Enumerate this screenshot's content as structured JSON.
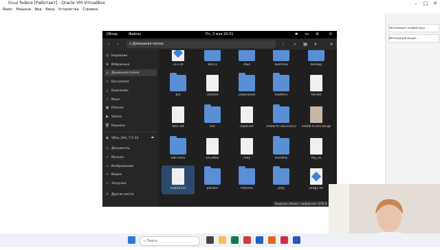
{
  "window": {
    "title": "linux fedora  [Работает] - Oracle VM VirtualBox"
  },
  "menu": [
    "Файл",
    "Машина",
    "Вид",
    "Ввод",
    "Устройства",
    "Справка"
  ],
  "topbar": {
    "overview": "Обзор",
    "app": "Файлы",
    "clock": "Пт, 3 мая  20:51",
    "lang": "ru"
  },
  "header": {
    "path": "Домашняя папка"
  },
  "sidebar": {
    "items": [
      {
        "label": "Недавние",
        "icon": "clock-icon"
      },
      {
        "label": "Избранные",
        "icon": "star-icon"
      },
      {
        "label": "Домашняя папка",
        "icon": "home-icon",
        "selected": true
      },
      {
        "label": "Documents",
        "icon": "folder-icon"
      },
      {
        "label": "Downloads",
        "icon": "download-icon"
      },
      {
        "label": "Music",
        "icon": "music-icon"
      },
      {
        "label": "Pictures",
        "icon": "image-icon"
      },
      {
        "label": "Videos",
        "icon": "video-icon"
      },
      {
        "label": "Корзина",
        "icon": "trash-icon"
      }
    ],
    "device": "VBox_GAs_7.0.14",
    "bookmarks": [
      {
        "label": "Документы",
        "icon": "folder-icon"
      },
      {
        "label": "Музыка",
        "icon": "folder-icon"
      },
      {
        "label": "Изображения",
        "icon": "folder-icon"
      },
      {
        "label": "Видео",
        "icon": "folder-icon"
      },
      {
        "label": "Загрузки",
        "icon": "folder-icon"
      }
    ],
    "other": "Другие места"
  },
  "files": [
    {
      "name": "111.sh",
      "kind": "script"
    },
    {
      "name": "abc11",
      "kind": "folder"
    },
    {
      "name": "ASD",
      "kind": "folder"
    },
    {
      "name": "australia",
      "kind": "folder"
    },
    {
      "name": "backup",
      "kind": "folder"
    },
    {
      "name": "bin",
      "kind": "folder"
    },
    {
      "name": "conf.txt",
      "kind": "doc"
    },
    {
      "name": "Downloads",
      "kind": "folder"
    },
    {
      "name": "feathers",
      "kind": "folder"
    },
    {
      "name": "file.txt",
      "kind": "doc"
    },
    {
      "name": "file1.txt",
      "kind": "doc"
    },
    {
      "name": "fun",
      "kind": "folder"
    },
    {
      "name": "input.txt",
      "kind": "doc"
    },
    {
      "name": "install-fc-20231012",
      "kind": "folder"
    },
    {
      "name": "install-tl-unx.tar.gz",
      "kind": "archive"
    },
    {
      "name": "lab-sssss",
      "kind": "folder"
    },
    {
      "name": "LICENSE",
      "kind": "doc"
    },
    {
      "name": "may",
      "kind": "doc"
    },
    {
      "name": "monthly",
      "kind": "folder"
    },
    {
      "name": "my_os",
      "kind": "doc"
    },
    {
      "name": "output.txt",
      "kind": "doc",
      "selected": true
    },
    {
      "name": "pandoc",
      "kind": "folder"
    },
    {
      "name": "Pictures",
      "kind": "folder"
    },
    {
      "name": "play",
      "kind": "folder"
    },
    {
      "name": "prog1.sh",
      "kind": "script"
    }
  ],
  "status": "Выделен объект «output.txt» (276 б",
  "taskbar": {
    "search": "Поиск"
  },
  "panel": {
    "items": [
      "Автозамыкт клавиатуры ...",
      "Интеграция мыши ..."
    ]
  }
}
